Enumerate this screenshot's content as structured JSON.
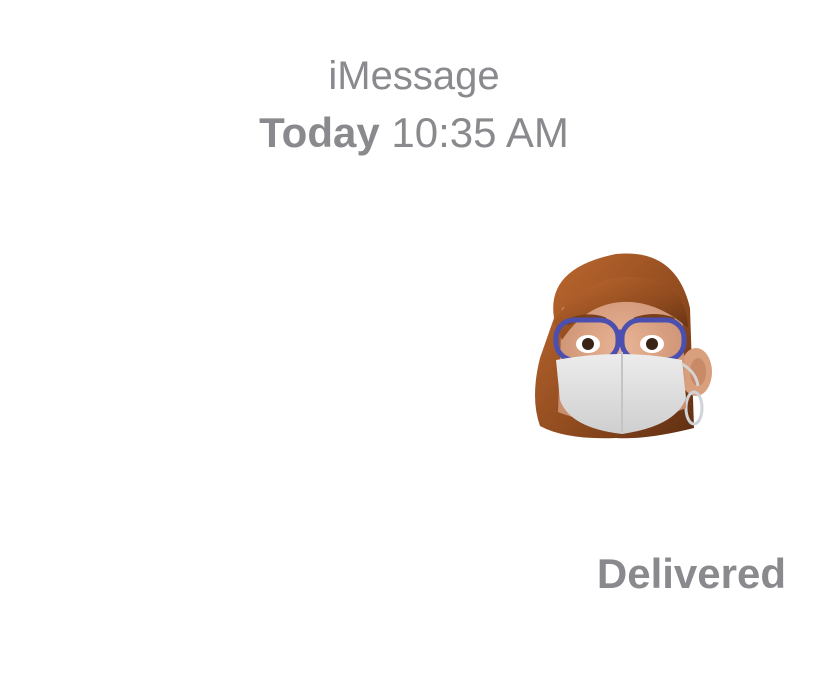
{
  "header": {
    "service_label": "iMessage",
    "day_label": "Today",
    "time_label": "10:35 AM"
  },
  "message": {
    "sticker": "memoji-with-glasses-and-face-mask",
    "status_label": "Delivered"
  },
  "colors": {
    "meta_text": "#8a8a8e",
    "background": "#ffffff"
  }
}
